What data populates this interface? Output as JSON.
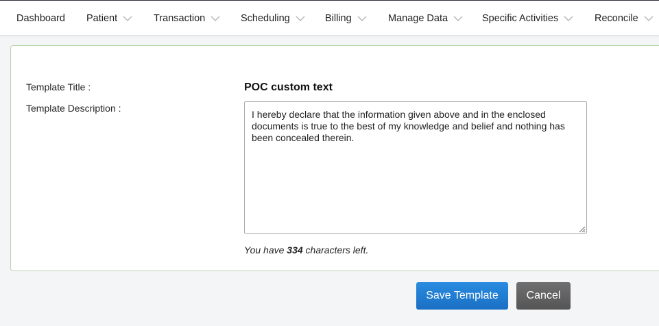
{
  "nav": {
    "items": [
      {
        "label": "Dashboard",
        "has_dropdown": false
      },
      {
        "label": "Patient",
        "has_dropdown": true
      },
      {
        "label": "Transaction",
        "has_dropdown": true
      },
      {
        "label": "Scheduling",
        "has_dropdown": true
      },
      {
        "label": "Billing",
        "has_dropdown": true
      },
      {
        "label": "Manage Data",
        "has_dropdown": true
      },
      {
        "label": "Specific Activities",
        "has_dropdown": true
      },
      {
        "label": "Reconcile",
        "has_dropdown": true
      }
    ]
  },
  "form": {
    "title_label": "Template Title :",
    "title_value": "POC custom text",
    "description_label": "Template Description :",
    "description_value": "I hereby declare that the information given above and in the enclosed documents is true to the best of my knowledge and belief and nothing has been concealed therein.",
    "chars_left_prefix": "You have",
    "chars_left_count": "334",
    "chars_left_suffix": "characters left."
  },
  "actions": {
    "save_label": "Save Template",
    "cancel_label": "Cancel"
  },
  "colors": {
    "primary": "#1a6fc4",
    "secondary": "#555555",
    "panel_border": "#b7d3a8"
  }
}
